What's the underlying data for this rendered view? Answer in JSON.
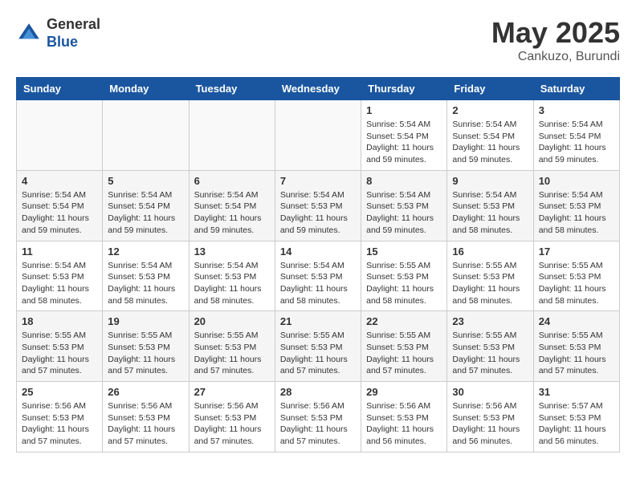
{
  "logo": {
    "general": "General",
    "blue": "Blue"
  },
  "title": {
    "month_year": "May 2025",
    "location": "Cankuzo, Burundi"
  },
  "days_of_week": [
    "Sunday",
    "Monday",
    "Tuesday",
    "Wednesday",
    "Thursday",
    "Friday",
    "Saturday"
  ],
  "weeks": [
    [
      {
        "day": "",
        "info": ""
      },
      {
        "day": "",
        "info": ""
      },
      {
        "day": "",
        "info": ""
      },
      {
        "day": "",
        "info": ""
      },
      {
        "day": "1",
        "info": "Sunrise: 5:54 AM\nSunset: 5:54 PM\nDaylight: 11 hours and 59 minutes."
      },
      {
        "day": "2",
        "info": "Sunrise: 5:54 AM\nSunset: 5:54 PM\nDaylight: 11 hours and 59 minutes."
      },
      {
        "day": "3",
        "info": "Sunrise: 5:54 AM\nSunset: 5:54 PM\nDaylight: 11 hours and 59 minutes."
      }
    ],
    [
      {
        "day": "4",
        "info": "Sunrise: 5:54 AM\nSunset: 5:54 PM\nDaylight: 11 hours and 59 minutes."
      },
      {
        "day": "5",
        "info": "Sunrise: 5:54 AM\nSunset: 5:54 PM\nDaylight: 11 hours and 59 minutes."
      },
      {
        "day": "6",
        "info": "Sunrise: 5:54 AM\nSunset: 5:54 PM\nDaylight: 11 hours and 59 minutes."
      },
      {
        "day": "7",
        "info": "Sunrise: 5:54 AM\nSunset: 5:53 PM\nDaylight: 11 hours and 59 minutes."
      },
      {
        "day": "8",
        "info": "Sunrise: 5:54 AM\nSunset: 5:53 PM\nDaylight: 11 hours and 59 minutes."
      },
      {
        "day": "9",
        "info": "Sunrise: 5:54 AM\nSunset: 5:53 PM\nDaylight: 11 hours and 58 minutes."
      },
      {
        "day": "10",
        "info": "Sunrise: 5:54 AM\nSunset: 5:53 PM\nDaylight: 11 hours and 58 minutes."
      }
    ],
    [
      {
        "day": "11",
        "info": "Sunrise: 5:54 AM\nSunset: 5:53 PM\nDaylight: 11 hours and 58 minutes."
      },
      {
        "day": "12",
        "info": "Sunrise: 5:54 AM\nSunset: 5:53 PM\nDaylight: 11 hours and 58 minutes."
      },
      {
        "day": "13",
        "info": "Sunrise: 5:54 AM\nSunset: 5:53 PM\nDaylight: 11 hours and 58 minutes."
      },
      {
        "day": "14",
        "info": "Sunrise: 5:54 AM\nSunset: 5:53 PM\nDaylight: 11 hours and 58 minutes."
      },
      {
        "day": "15",
        "info": "Sunrise: 5:55 AM\nSunset: 5:53 PM\nDaylight: 11 hours and 58 minutes."
      },
      {
        "day": "16",
        "info": "Sunrise: 5:55 AM\nSunset: 5:53 PM\nDaylight: 11 hours and 58 minutes."
      },
      {
        "day": "17",
        "info": "Sunrise: 5:55 AM\nSunset: 5:53 PM\nDaylight: 11 hours and 58 minutes."
      }
    ],
    [
      {
        "day": "18",
        "info": "Sunrise: 5:55 AM\nSunset: 5:53 PM\nDaylight: 11 hours and 57 minutes."
      },
      {
        "day": "19",
        "info": "Sunrise: 5:55 AM\nSunset: 5:53 PM\nDaylight: 11 hours and 57 minutes."
      },
      {
        "day": "20",
        "info": "Sunrise: 5:55 AM\nSunset: 5:53 PM\nDaylight: 11 hours and 57 minutes."
      },
      {
        "day": "21",
        "info": "Sunrise: 5:55 AM\nSunset: 5:53 PM\nDaylight: 11 hours and 57 minutes."
      },
      {
        "day": "22",
        "info": "Sunrise: 5:55 AM\nSunset: 5:53 PM\nDaylight: 11 hours and 57 minutes."
      },
      {
        "day": "23",
        "info": "Sunrise: 5:55 AM\nSunset: 5:53 PM\nDaylight: 11 hours and 57 minutes."
      },
      {
        "day": "24",
        "info": "Sunrise: 5:55 AM\nSunset: 5:53 PM\nDaylight: 11 hours and 57 minutes."
      }
    ],
    [
      {
        "day": "25",
        "info": "Sunrise: 5:56 AM\nSunset: 5:53 PM\nDaylight: 11 hours and 57 minutes."
      },
      {
        "day": "26",
        "info": "Sunrise: 5:56 AM\nSunset: 5:53 PM\nDaylight: 11 hours and 57 minutes."
      },
      {
        "day": "27",
        "info": "Sunrise: 5:56 AM\nSunset: 5:53 PM\nDaylight: 11 hours and 57 minutes."
      },
      {
        "day": "28",
        "info": "Sunrise: 5:56 AM\nSunset: 5:53 PM\nDaylight: 11 hours and 57 minutes."
      },
      {
        "day": "29",
        "info": "Sunrise: 5:56 AM\nSunset: 5:53 PM\nDaylight: 11 hours and 56 minutes."
      },
      {
        "day": "30",
        "info": "Sunrise: 5:56 AM\nSunset: 5:53 PM\nDaylight: 11 hours and 56 minutes."
      },
      {
        "day": "31",
        "info": "Sunrise: 5:57 AM\nSunset: 5:53 PM\nDaylight: 11 hours and 56 minutes."
      }
    ]
  ]
}
